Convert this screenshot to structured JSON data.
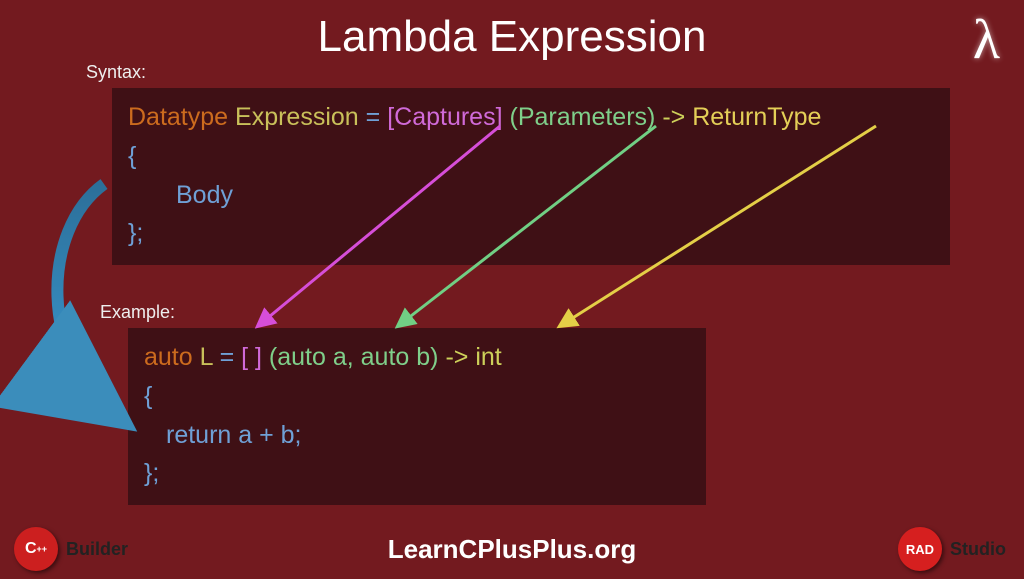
{
  "title": "Lambda Expression",
  "lambda_glyph": "λ",
  "labels": {
    "syntax": "Syntax:",
    "example": "Example:"
  },
  "syntax": {
    "datatype": "Datatype",
    "expression": "Expression",
    "eq": "=",
    "captures": "[Captures]",
    "parameters": "(Parameters)",
    "arrow": "->",
    "returntype": "ReturnType",
    "open": "{",
    "body": "Body",
    "close": "};"
  },
  "example": {
    "auto": "auto",
    "L": "L",
    "eq": "=",
    "captures": "[ ]",
    "params": "(auto a, auto b)",
    "arrow": "->",
    "ret": "int",
    "open": "{",
    "body": "return a + b;",
    "close": "};"
  },
  "footer": {
    "site": "LearnCPlusPlus.org",
    "left_badge": {
      "circle": "C",
      "sub": "++",
      "text": "Builder"
    },
    "right_badge": {
      "circle": "RAD",
      "text": "Studio"
    }
  }
}
